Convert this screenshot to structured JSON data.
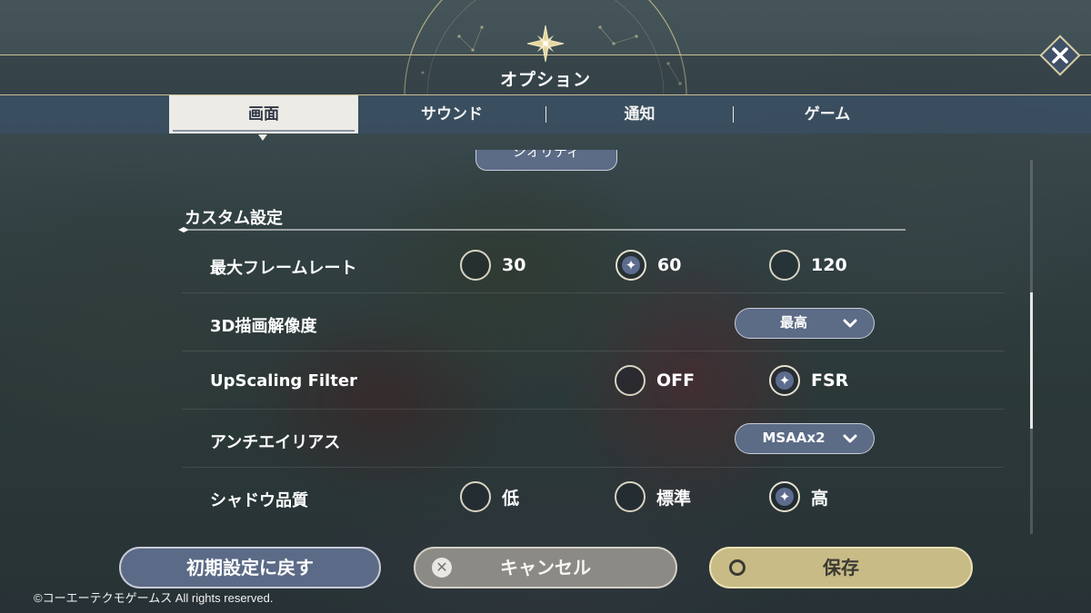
{
  "header": {
    "title": "オプション",
    "close_label": "✕"
  },
  "tabs": [
    {
      "label": "画面",
      "active": true
    },
    {
      "label": "サウンド",
      "active": false
    },
    {
      "label": "通知",
      "active": false
    },
    {
      "label": "ゲーム",
      "active": false
    }
  ],
  "partial_dropdown": {
    "value": "シオリティ"
  },
  "section": {
    "title": "カスタム設定"
  },
  "settings": {
    "frame_rate": {
      "label": "最大フレームレート",
      "options": [
        "30",
        "60",
        "120"
      ],
      "selected": "60"
    },
    "render_resolution": {
      "label": "3D描画解像度",
      "value": "最高"
    },
    "upscaling": {
      "label": "UpScaling Filter",
      "options": [
        "OFF",
        "FSR"
      ],
      "selected": "FSR"
    },
    "antialiasing": {
      "label": "アンチエイリアス",
      "value": "MSAAx2"
    },
    "shadow_quality": {
      "label": "シャドウ品質",
      "options": [
        "低",
        "標準",
        "高"
      ],
      "selected": "高"
    }
  },
  "buttons": {
    "reset": "初期設定に戻す",
    "cancel": "キャンセル",
    "save": "保存"
  },
  "footer": {
    "copyright": "©コーエーテクモゲームス All rights reserved."
  },
  "colors": {
    "accent_gold": "#cbbf92",
    "selection_blue": "#5c6b86",
    "save_gold": "#c8bb86"
  }
}
